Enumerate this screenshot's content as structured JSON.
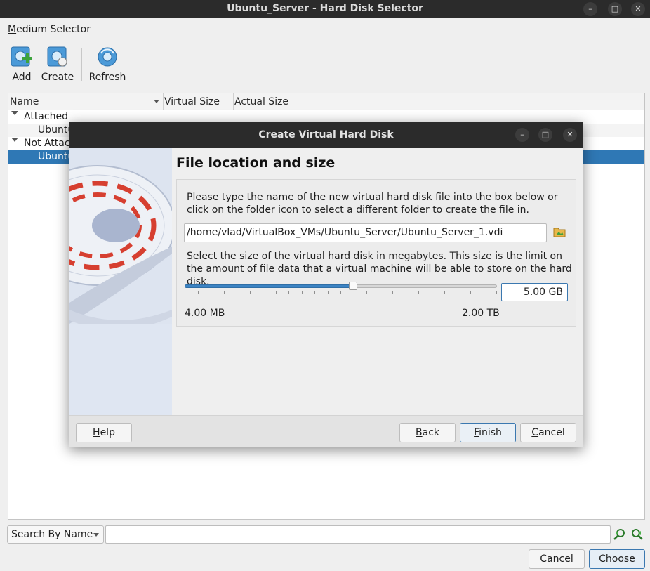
{
  "window": {
    "title": "Ubuntu_Server - Hard Disk Selector",
    "controls": {
      "minimize": "–",
      "maximize": "□",
      "close": "✕"
    }
  },
  "menu": {
    "medium_selector": "Medium Selector"
  },
  "toolbar": {
    "add": "Add",
    "create": "Create",
    "refresh": "Refresh"
  },
  "table": {
    "columns": [
      "Name",
      "Virtual Size",
      "Actual Size"
    ],
    "groups": [
      {
        "label": "Attached",
        "items": [
          "Ubuntu"
        ]
      },
      {
        "label": "Not Attac",
        "items": [
          "Ubuntu"
        ]
      }
    ]
  },
  "search": {
    "mode": "Search By Name",
    "value": ""
  },
  "buttons": {
    "cancel": "Cancel",
    "choose": "Choose"
  },
  "dialog": {
    "title": "Create Virtual Hard Disk",
    "heading": "File location and size",
    "location_text": "Please type the name of the new virtual hard disk file into the box below or click on the folder icon to select a different folder to create the file in.",
    "path": "/home/vlad/VirtualBox_VMs/Ubuntu_Server/Ubuntu_Server_1.vdi",
    "size_text": "Select the size of the virtual hard disk in megabytes. This size is the limit on the amount of file data that a virtual machine will be able to store on the hard disk.",
    "size_value": "5.00 GB",
    "slider_fraction": 0.54,
    "min_label": "4.00 MB",
    "max_label": "2.00 TB",
    "buttons": {
      "help": "Help",
      "back": "Back",
      "finish": "Finish",
      "cancel": "Cancel"
    }
  },
  "colors": {
    "accent": "#3c83c3",
    "selection": "#2f78b5",
    "titlebar": "#2b2b2b"
  }
}
